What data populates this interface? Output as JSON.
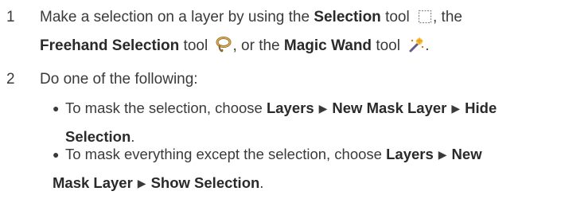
{
  "steps": [
    {
      "number": "1",
      "line1": {
        "t1": "Make a selection on a layer by using the ",
        "b1": "Selection",
        "t2": " tool",
        "t3": ", the"
      },
      "line2": {
        "b1": "Freehand Selection",
        "t1": " tool",
        "t2": ", or the ",
        "b2": "Magic Wand",
        "t3": " tool",
        "t4": "."
      },
      "icons": [
        "selection-tool-icon",
        "freehand-selection-tool-icon",
        "magic-wand-tool-icon"
      ]
    },
    {
      "number": "2",
      "text": "Do one of the following:",
      "bullets": [
        {
          "lead": "To mask the selection, choose ",
          "menu1": "Layers",
          "menu2": "New Mask Layer",
          "menu3": "Hide",
          "menu3_cont": "Selection",
          "end": "."
        },
        {
          "lead": "To mask everything except the selection, choose ",
          "menu1": "Layers",
          "menu2a": "New",
          "menu2b": "Mask Layer",
          "menu3": "Show Selection",
          "end": "."
        }
      ]
    }
  ],
  "separator": "▶"
}
